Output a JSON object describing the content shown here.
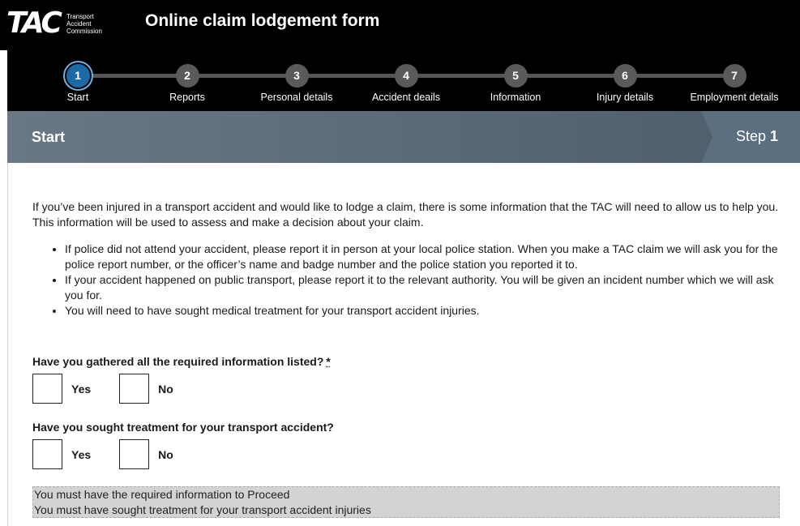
{
  "header": {
    "logo_text": "TAC",
    "logo_words": [
      "Transport",
      "Accident",
      "Commission"
    ],
    "title": "Online claim lodgement form"
  },
  "stepper": {
    "steps": [
      {
        "number": "1",
        "label": "Start",
        "active": true
      },
      {
        "number": "2",
        "label": "Reports",
        "active": false
      },
      {
        "number": "3",
        "label": "Personal details",
        "active": false
      },
      {
        "number": "4",
        "label": "Accident deails",
        "active": false
      },
      {
        "number": "5",
        "label": "Information",
        "active": false
      },
      {
        "number": "6",
        "label": "Injury details",
        "active": false
      },
      {
        "number": "7",
        "label": "Employment details",
        "active": false
      }
    ]
  },
  "section": {
    "title": "Start",
    "step_prefix": "Step",
    "step_number": "1"
  },
  "intro": "If you’ve been injured in a transport accident and would like to lodge a claim, there is some information that the TAC will need to allow us to help you. This information will be used to assess and make a decision about your claim.",
  "bullets": [
    "If police did not attend your accident, please report it in person at your local police station. When you make a TAC claim we will ask you for the police report number, or the officer’s name and badge number and the police station you reported it to.",
    "If your accident happened on public transport, please report it to the relevant authority. You will be given an incident number which we will ask you for.",
    "You will need to have sought medical treatment for your transport accident injuries."
  ],
  "questions": {
    "q1": {
      "text": "Have you gathered all the required information listed?",
      "required_mark": "*",
      "yes": "Yes",
      "no": "No"
    },
    "q2": {
      "text": "Have you sought treatment for your transport accident?",
      "yes": "Yes",
      "no": "No"
    }
  },
  "notice": {
    "line1": "You must have the required information to Proceed",
    "line2": "You must have sought treatment for your transport accident injuries"
  }
}
